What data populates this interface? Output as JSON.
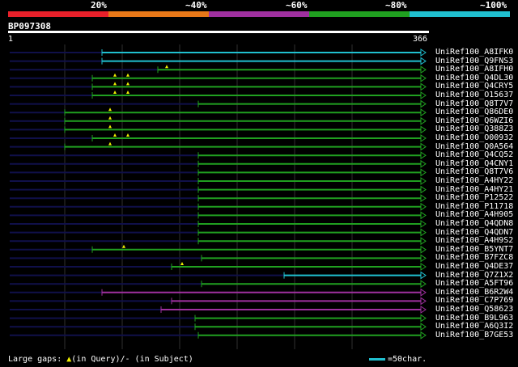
{
  "legend": {
    "labels": [
      "20%",
      "~40%",
      "~60%",
      "~80%",
      "~100%"
    ],
    "colors": [
      "#e8202a",
      "#e87818",
      "#a030a0",
      "#20a020",
      "#20c0d0"
    ]
  },
  "query": {
    "id": "BP097308",
    "start": "1",
    "end": "366"
  },
  "colors": {
    "green": "#20a020",
    "cyan": "#20c0d0",
    "magenta": "#a030a0",
    "gap": "#10104a",
    "grid": "#303030"
  },
  "hits": [
    {
      "label": "UniRef100_A8IFK0",
      "color": "cyan",
      "start": 126,
      "gaps": []
    },
    {
      "label": "UniRef100_Q9FNS3",
      "color": "cyan",
      "start": 126,
      "gaps": []
    },
    {
      "label": "UniRef100_A8IFH0",
      "color": "green",
      "start": 195,
      "gaps": [
        206
      ]
    },
    {
      "label": "UniRef100_Q4DL30",
      "color": "green",
      "start": 114,
      "gaps": [
        142,
        158
      ]
    },
    {
      "label": "UniRef100_Q4CRY5",
      "color": "green",
      "start": 114,
      "gaps": [
        142,
        158
      ]
    },
    {
      "label": "UniRef100_O15637",
      "color": "green",
      "start": 114,
      "gaps": [
        142,
        158
      ]
    },
    {
      "label": "UniRef100_Q8T7V7",
      "color": "green",
      "start": 245,
      "gaps": []
    },
    {
      "label": "UniRef100_Q86DE0",
      "color": "green",
      "start": 80,
      "gaps": [
        136
      ]
    },
    {
      "label": "UniRef100_Q6WZI6",
      "color": "green",
      "start": 80,
      "gaps": [
        136
      ]
    },
    {
      "label": "UniRef100_Q388Z3",
      "color": "green",
      "start": 80,
      "gaps": [
        136
      ]
    },
    {
      "label": "UniRef100_O00932",
      "color": "green",
      "start": 114,
      "gaps": [
        142,
        158
      ]
    },
    {
      "label": "UniRef100_Q0A564",
      "color": "green",
      "start": 80,
      "gaps": [
        136
      ]
    },
    {
      "label": "UniRef100_Q4CQ52",
      "color": "green",
      "start": 245,
      "gaps": []
    },
    {
      "label": "UniRef100_Q4CNY1",
      "color": "green",
      "start": 245,
      "gaps": []
    },
    {
      "label": "UniRef100_Q8T7V6",
      "color": "green",
      "start": 245,
      "gaps": []
    },
    {
      "label": "UniRef100_A4HY22",
      "color": "green",
      "start": 245,
      "gaps": []
    },
    {
      "label": "UniRef100_A4HY21",
      "color": "green",
      "start": 245,
      "gaps": []
    },
    {
      "label": "UniRef100_P12522",
      "color": "green",
      "start": 245,
      "gaps": []
    },
    {
      "label": "UniRef100_P11718",
      "color": "green",
      "start": 245,
      "gaps": []
    },
    {
      "label": "UniRef100_A4H905",
      "color": "green",
      "start": 245,
      "gaps": []
    },
    {
      "label": "UniRef100_Q4QDN8",
      "color": "green",
      "start": 245,
      "gaps": []
    },
    {
      "label": "UniRef100_Q4QDN7",
      "color": "green",
      "start": 245,
      "gaps": []
    },
    {
      "label": "UniRef100_A4H9S2",
      "color": "green",
      "start": 245,
      "gaps": []
    },
    {
      "label": "UniRef100_B5YNT7",
      "color": "green",
      "start": 114,
      "gaps": [
        153
      ]
    },
    {
      "label": "UniRef100_B7FZC8",
      "color": "green",
      "start": 249,
      "gaps": []
    },
    {
      "label": "UniRef100_Q4DE37",
      "color": "green",
      "start": 212,
      "gaps": [
        225
      ]
    },
    {
      "label": "UniRef100_Q7Z1X2",
      "color": "cyan",
      "start": 351,
      "gaps": []
    },
    {
      "label": "UniRef100_A5FT96",
      "color": "green",
      "start": 249,
      "gaps": []
    },
    {
      "label": "UniRef100_B6R2W4",
      "color": "magenta",
      "start": 126,
      "gaps": []
    },
    {
      "label": "UniRef100_C7P769",
      "color": "magenta",
      "start": 212,
      "gaps": []
    },
    {
      "label": "UniRef100_Q58623",
      "color": "magenta",
      "start": 199,
      "gaps": []
    },
    {
      "label": "UniRef100_B9L963",
      "color": "green",
      "start": 241,
      "gaps": []
    },
    {
      "label": "UniRef100_A6Q3I2",
      "color": "green",
      "start": 241,
      "gaps": []
    },
    {
      "label": "UniRef100_B7GE53",
      "color": "green",
      "start": 245,
      "gaps": []
    }
  ],
  "footer": {
    "prefix": "Large gaps: ",
    "triangle": "▲",
    "suffix": "(in Query)/- (in Subject)",
    "scale": "=50char."
  }
}
